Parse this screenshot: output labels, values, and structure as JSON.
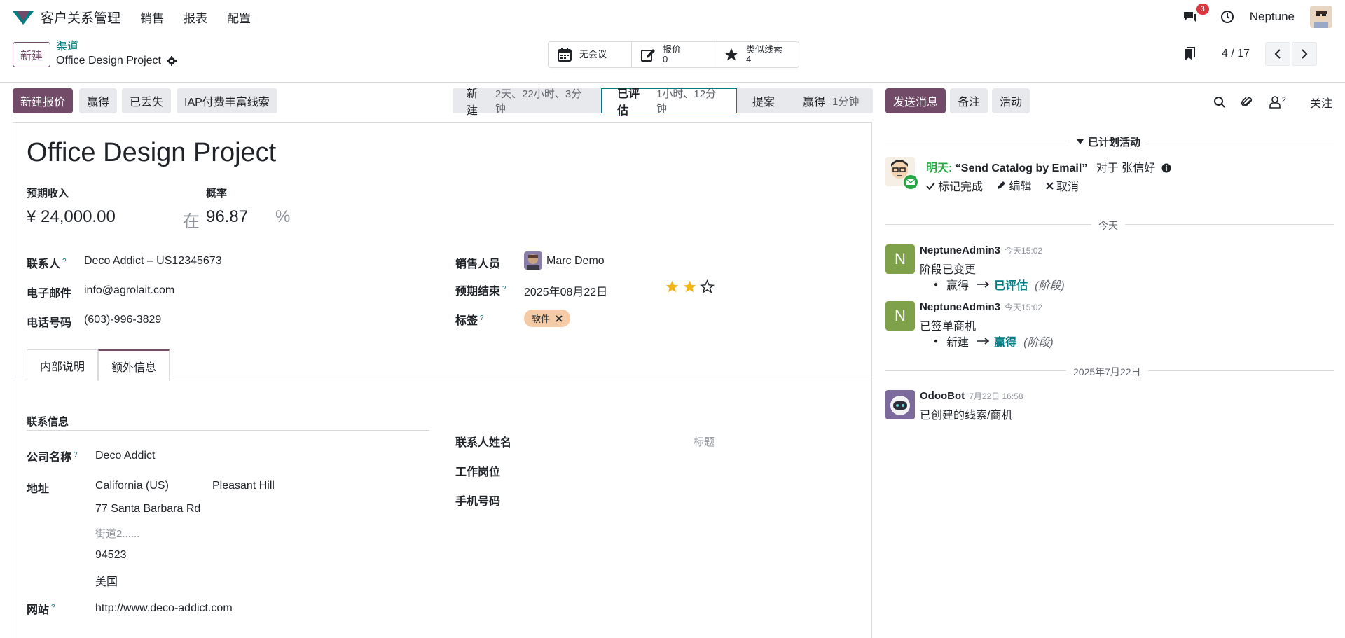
{
  "topbar": {
    "app_title": "客户关系管理",
    "menu": [
      "销售",
      "报表",
      "配置"
    ],
    "messages_count": "3",
    "user_name": "Neptune"
  },
  "control": {
    "new_button": "新建",
    "breadcrumb_parent": "渠道",
    "breadcrumb_current": "Office Design Project",
    "smart_buttons": [
      {
        "label": "无会议",
        "value": "",
        "icon": "calendar-icon"
      },
      {
        "label": "报价",
        "value": "0",
        "icon": "edit-icon"
      },
      {
        "label": "类似线索",
        "value": "4",
        "icon": "star-icon"
      }
    ],
    "pager": "4 / 17"
  },
  "actions": {
    "new_quotation": "新建报价",
    "won": "赢得",
    "lost": "已丢失",
    "enrich": "IAP付费丰富线索"
  },
  "stages": [
    {
      "name": "新建",
      "duration": "2天、22小时、3分钟"
    },
    {
      "name": "已评估",
      "duration": "1小时、12分钟"
    },
    {
      "name": "提案",
      "duration": ""
    },
    {
      "name": "赢得",
      "duration": "1分钟"
    }
  ],
  "form": {
    "title": "Office Design Project",
    "expected_revenue_label": "预期收入",
    "expected_revenue": "¥ 24,000.00",
    "at_label": "在",
    "probability_label": "概率",
    "probability": "96.87",
    "percent": "%",
    "contact_label": "联系人",
    "contact": "Deco Addict – US12345673",
    "email_label": "电子邮件",
    "email": "info@agrolait.com",
    "phone_label": "电话号码",
    "phone": "(603)-996-3829",
    "salesperson_label": "销售人员",
    "salesperson": "Marc Demo",
    "expected_closing_label": "预期结束",
    "expected_closing": "2025年08月22日",
    "priority_stars": 2,
    "priority_max": 3,
    "tags_label": "标签",
    "tag": "软件",
    "help_mark": "?"
  },
  "tabs": [
    "内部说明",
    "额外信息"
  ],
  "extra": {
    "section_title": "联系信息",
    "company_label": "公司名称",
    "company": "Deco Addict",
    "address_label": "地址",
    "state": "California (US)",
    "city": "Pleasant Hill",
    "street": "77 Santa Barbara Rd",
    "street2_placeholder": "街道2......",
    "zip": "94523",
    "country": "美国",
    "website_label": "网站",
    "website": "http://www.deco-addict.com",
    "contact_name_label": "联系人姓名",
    "title_placeholder": "标题",
    "job_label": "工作岗位",
    "mobile_label": "手机号码"
  },
  "chatter": {
    "send_message": "发送消息",
    "log_note": "备注",
    "activity": "活动",
    "followers_count": "2",
    "follow": "关注",
    "planned_title": "已计划活动",
    "activity_due": "明天:",
    "activity_summary": "“Send Catalog by Email”",
    "activity_for": "对于 张信好",
    "mark_done": "标记完成",
    "edit": "编辑",
    "cancel": "取消",
    "today_divider": "今天",
    "date_divider": "2025年7月22日",
    "messages": [
      {
        "author": "NeptuneAdmin3",
        "time": "今天15:02",
        "body": "阶段已变更",
        "old": "赢得",
        "new": "已评估",
        "field": "(阶段)",
        "avatar_letter": "N"
      },
      {
        "author": "NeptuneAdmin3",
        "time": "今天15:02",
        "body": "已签单商机",
        "old": "新建",
        "new": "赢得",
        "field": "(阶段)",
        "avatar_letter": "N"
      },
      {
        "author": "OdooBot",
        "time": "7月22日 16:58",
        "body": "已创建的线索/商机"
      }
    ]
  },
  "colors": {
    "primary": "#714b67",
    "accent": "#017e84",
    "tag_bg": "#f5cba7",
    "avatar_green": "#7fa14a",
    "due_green": "#28a745",
    "star": "#f3b41a"
  }
}
